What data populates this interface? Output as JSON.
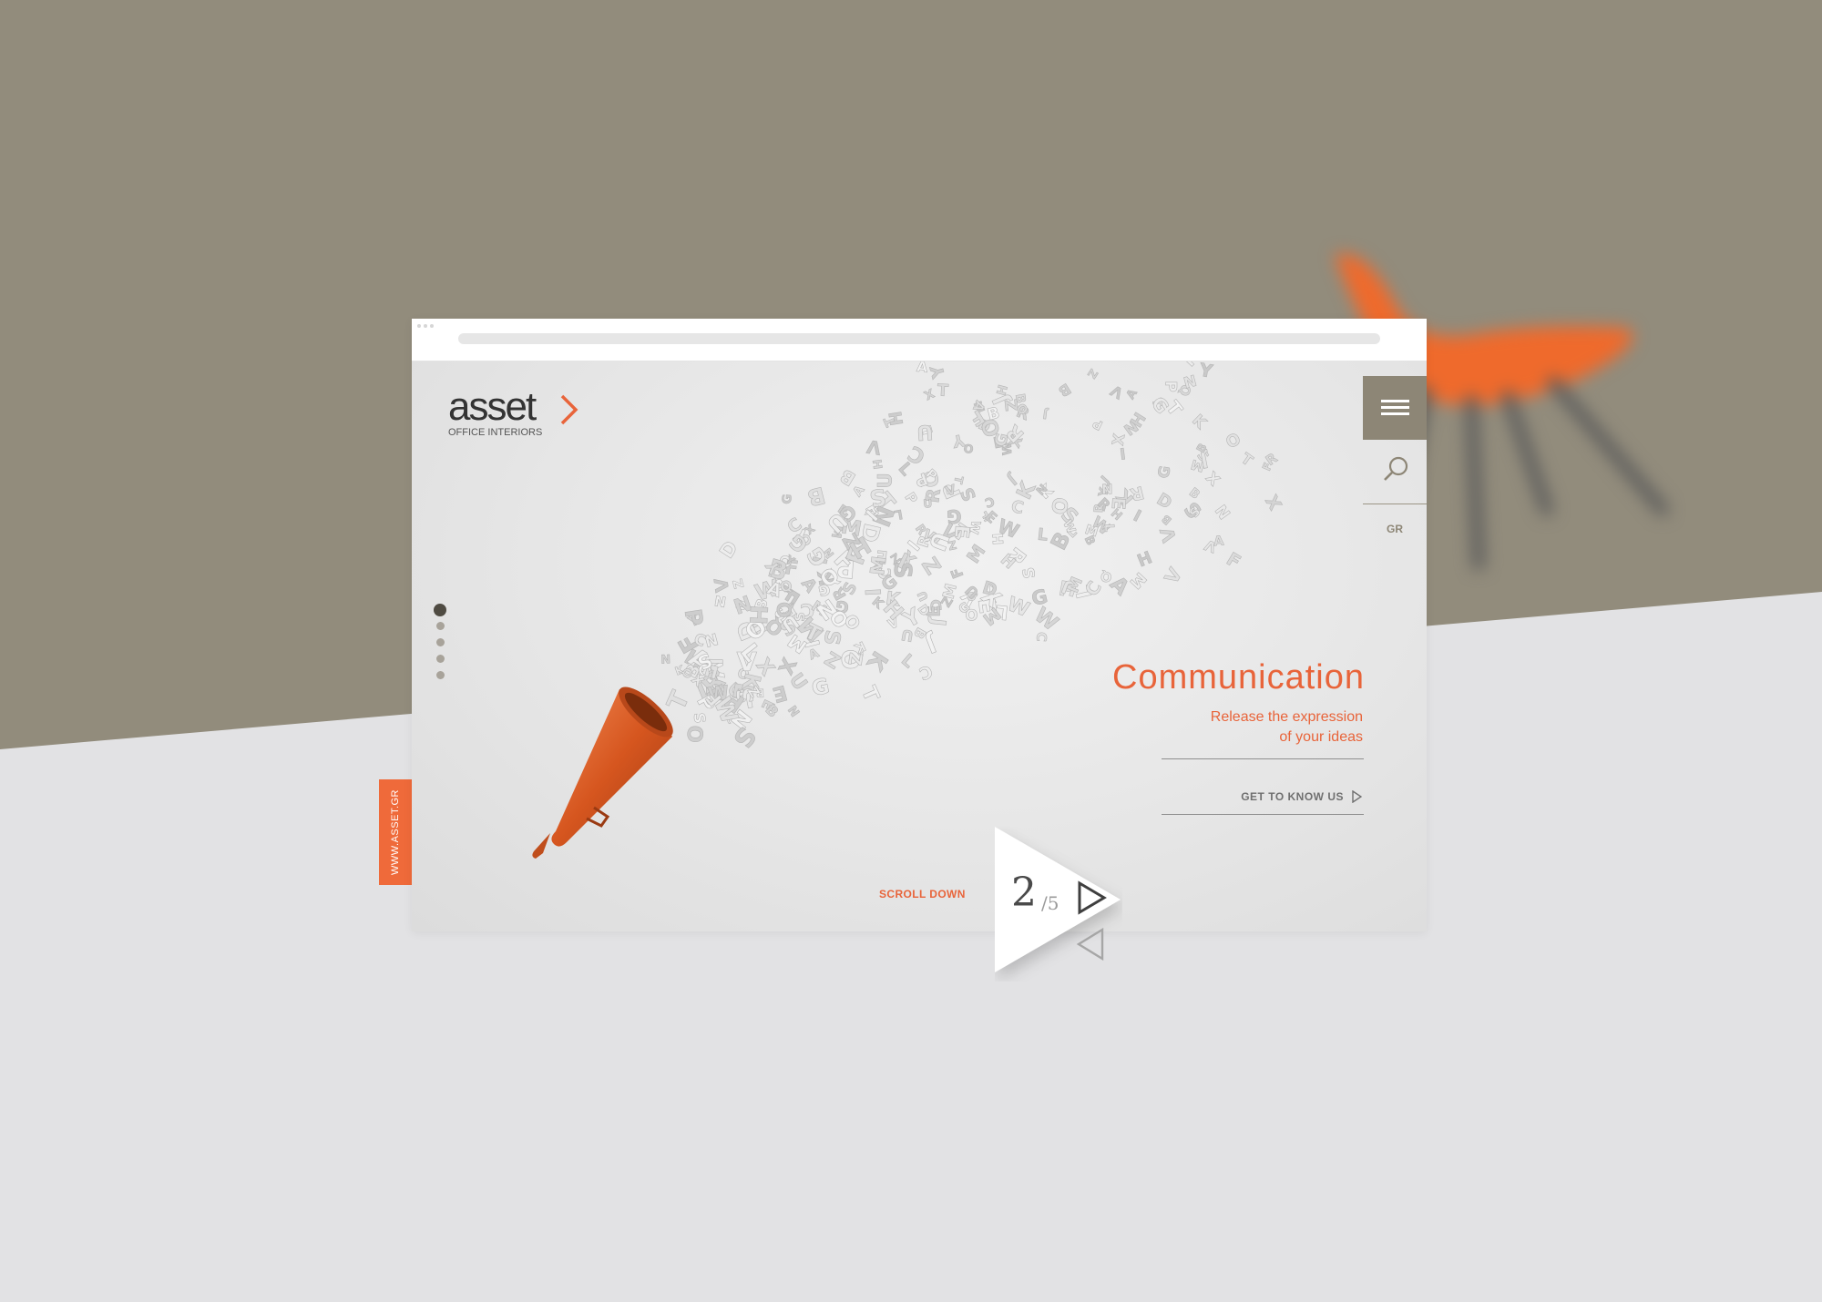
{
  "site": {
    "logo_word": "asset",
    "logo_sub": "OFFICE INTERIORS",
    "side_tab": "WWW.ASSET.GR"
  },
  "nav": {
    "menu_icon": "hamburger-icon",
    "search_icon": "search-icon",
    "lang": "GR"
  },
  "hero": {
    "title": "Communication",
    "subtitle_line1": "Release the expression",
    "subtitle_line2": "of your ideas",
    "cta": "GET TO KNOW US",
    "scroll": "SCROLL DOWN",
    "image_icon": "megaphone-icon"
  },
  "slider": {
    "current": "2",
    "total": "/5",
    "next_icon": "triangle-right-icon",
    "prev_icon": "triangle-left-icon",
    "dots_count": 5,
    "active_dot": 1
  },
  "colors": {
    "accent": "#e8643a",
    "olive": "#8d8676",
    "backdrop_top": "#928c7c",
    "backdrop_bottom": "#e2e2e4"
  }
}
